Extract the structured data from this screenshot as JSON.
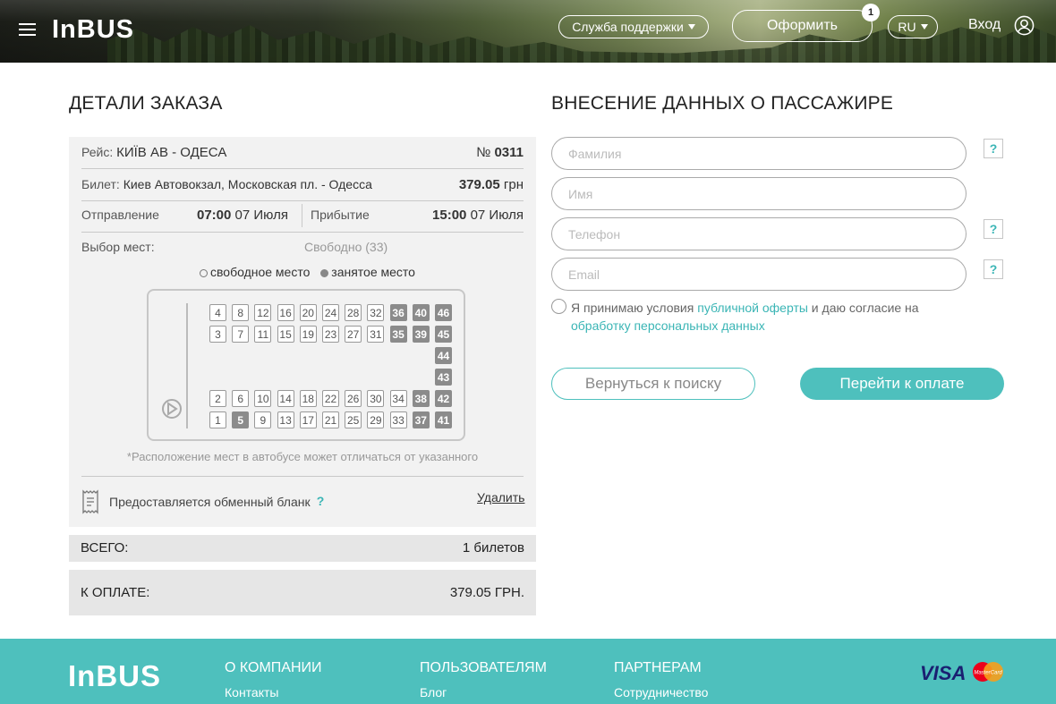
{
  "header": {
    "logo": "InBUS",
    "support": "Служба поддержки",
    "order_btn": "Оформить",
    "badge": "1",
    "lang": "RU",
    "login": "Вход"
  },
  "order": {
    "title": "ДЕТАЛИ ЗАКАЗА",
    "route_label": "Рейс:",
    "route_value": "КИЇВ АВ - ОДЕСА",
    "route_no_label": "№",
    "route_no": "0311",
    "ticket_label": "Билет:",
    "ticket_value": "Киев Автовокзал, Московская пл. - Одесса",
    "price": "379.05",
    "currency": "грн",
    "depart_label": "Отправление",
    "depart_time": "07:00",
    "depart_date": "07 Июля",
    "arrive_label": "Прибытие",
    "arrive_time": "15:00",
    "arrive_date": "07 Июля",
    "seats_label": "Выбор мест:",
    "free_info": "Свободно (33)",
    "legend_free": "свободное место",
    "legend_busy": "занятое место",
    "note": "Расположение мест в автобусе может отличаться от указанного",
    "exchange": "Предоставляется обменный бланк",
    "exchange_help": "?",
    "delete": "Удалить"
  },
  "seats": {
    "row_top1": [
      4,
      8,
      12,
      16,
      20,
      24,
      28,
      32,
      36,
      40,
      46
    ],
    "row_top2": [
      3,
      7,
      11,
      15,
      19,
      23,
      27,
      31,
      35,
      39,
      45
    ],
    "back": [
      44,
      43
    ],
    "row_bot1": [
      2,
      6,
      10,
      14,
      18,
      22,
      26,
      30,
      34,
      38,
      42
    ],
    "row_bot2": [
      1,
      5,
      9,
      13,
      17,
      21,
      25,
      29,
      33,
      37,
      41
    ],
    "busy": [
      36,
      40,
      46,
      35,
      39,
      45,
      44,
      43,
      38,
      42,
      5,
      37,
      41
    ]
  },
  "totals": {
    "total_label": "ВСЕГО:",
    "total_value": "1 билетов",
    "pay_label": "К ОПЛАТЕ:",
    "pay_value": "379.05 ГРН."
  },
  "passenger": {
    "title": "ВНЕСЕНИЕ ДАННЫХ О ПАССАЖИРЕ",
    "surname_ph": "Фамилия",
    "name_ph": "Имя",
    "phone_ph": "Телефон",
    "email_ph": "Email",
    "help": "?",
    "agree_1": "Я принимаю условия ",
    "agree_link1": "публичной оферты",
    "agree_2": " и даю согласие на ",
    "agree_link2": "обработку персональных данных",
    "back_btn": "Вернуться к поиску",
    "pay_btn": "Перейти к оплате"
  },
  "footer": {
    "logo": "InBUS",
    "col1_title": "О КОМПАНИИ",
    "col1_link": "Контакты",
    "col2_title": "ПОЛЬЗОВАТЕЛЯМ",
    "col2_link": "Блог",
    "col3_title": "ПАРТНЕРАМ",
    "col3_link": "Сотрудничество",
    "visa": "VISA",
    "mastercard": "MasterCard"
  },
  "colors": {
    "accent": "#4ec0bd",
    "link": "#3ab5b5",
    "busy_seat": "#8b8b8b"
  }
}
